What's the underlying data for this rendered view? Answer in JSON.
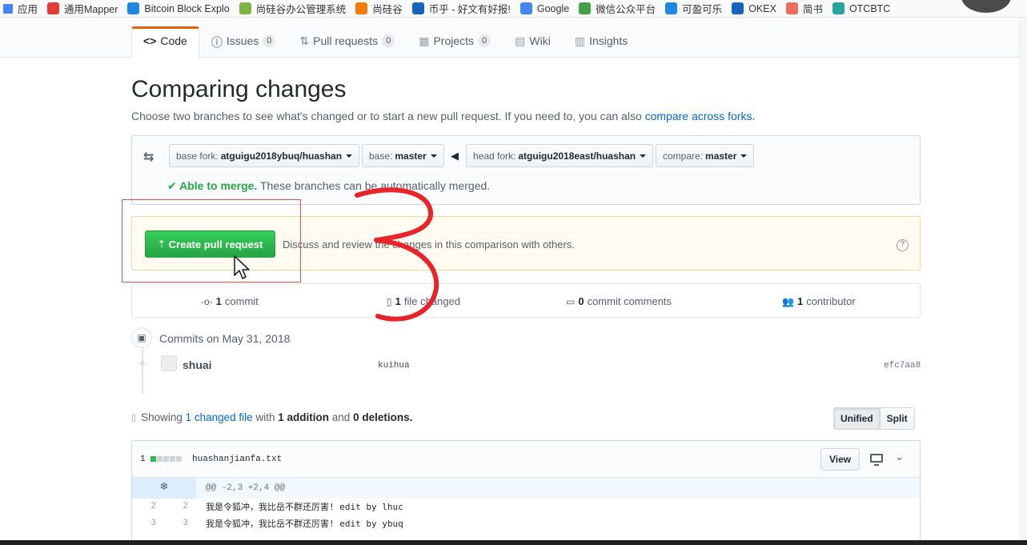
{
  "bookmarks": [
    "应用",
    "通用Mapper",
    "Bitcoin Block Explo",
    "尚硅谷办公管理系统",
    "尚硅谷",
    "币乎 - 好文有好报!",
    "Google",
    "微信公众平台",
    "可盈可乐",
    "OKEX",
    "简书",
    "OTCBTC"
  ],
  "bookmark_colors": [
    "#4285f4",
    "#e53935",
    "#1e88e5",
    "#7cb342",
    "#f57c00",
    "#1565c0",
    "#4285f4",
    "#43a047",
    "#1e88e5",
    "#1565c0",
    "#ea6f5a",
    "#26a69a"
  ],
  "repo_nav": {
    "tabs": [
      {
        "icon": "<>",
        "label": "Code"
      },
      {
        "icon": "ⓘ",
        "label": "Issues",
        "count": "0"
      },
      {
        "icon": "⇅",
        "label": "Pull requests",
        "count": "0"
      },
      {
        "icon": "▦",
        "label": "Projects",
        "count": "0"
      },
      {
        "icon": "▤",
        "label": "Wiki"
      },
      {
        "icon": "▥",
        "label": "Insights"
      }
    ]
  },
  "page": {
    "title": "Comparing changes",
    "subtitle": "Choose two branches to see what's changed or to start a new pull request. If you need to, you can also ",
    "subtitle_link": "compare across forks."
  },
  "range": {
    "base_fork_label": "base fork:",
    "base_fork_value": "atguigu2018ybuq/huashan",
    "base_label": "base:",
    "base_value": "master",
    "head_fork_label": "head fork:",
    "head_fork_value": "atguigu2018east/huashan",
    "compare_label": "compare:",
    "compare_value": "master",
    "merge_ok": "Able to merge.",
    "merge_msg": " These branches can be automatically merged."
  },
  "pr": {
    "button_label": "Create pull request",
    "description": "Discuss and review the changes in this comparison with others."
  },
  "summary": {
    "commits_n": "1",
    "commits_label": "commit",
    "files_n": "1",
    "files_label": "file changed",
    "comments_n": "0",
    "comments_label": "commit comments",
    "contributors_n": "1",
    "contributors_label": "contributor"
  },
  "commits": {
    "date_header": "Commits on May 31, 2018",
    "author": "shuai",
    "message": "kuihua",
    "sha": "efc7aa8"
  },
  "diff_summary": {
    "showing": "Showing",
    "changed_files": "1 changed file",
    "with": "with",
    "additions": "1 addition",
    "and": "and",
    "deletions": "0 deletions."
  },
  "view_toggle": {
    "unified": "Unified",
    "split": "Split"
  },
  "file": {
    "count": "1",
    "name": "huashanjianfa.txt",
    "view_label": "View",
    "hunk": "@@ -2,3 +2,4 @@",
    "lines": [
      {
        "old": "2",
        "new": "2",
        "text": "我是令狐冲，我比岳不群还厉害! edit by lhuc"
      },
      {
        "old": "3",
        "new": "3",
        "text": "我是令狐冲，我比岳不群还厉害! edit by ybuq"
      }
    ]
  },
  "annotation": {
    "mark": "3",
    "color": "#e8232a"
  }
}
